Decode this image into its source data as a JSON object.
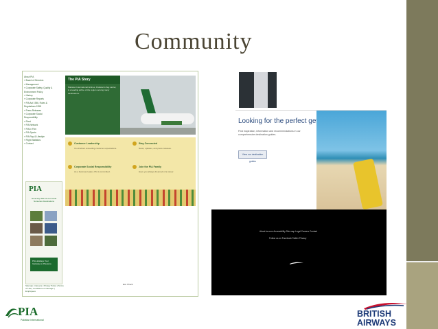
{
  "slide": {
    "title": "Community"
  },
  "pia_screenshot": {
    "sidebar_items": [
      "About PIA",
      "» Board of Directors",
      "» Management",
      "» Corporate Safety, Quality &",
      "  Environment Policy",
      "» History",
      "» Corporate Reports",
      "» PIA Act 1956, Rules &",
      "  Regulations 1958",
      "» Press Releases",
      "» Corporate Social",
      "  Responsibility",
      "» Fleet",
      "» PIA Network",
      "» PIA in Film",
      "» PIA Sports",
      "» PIA Rap & Lifestyle",
      "» Flight Statistics",
      "» Contact"
    ],
    "story_heading": "The PIA Story",
    "story_text": "Pakistan International Airlines, Pakistan's flag carrier, is a leading airline of the region serving many destinations.",
    "ad_logo": "PIA",
    "ad_text": "Great Fly With Us for Great Nurseries Destinations",
    "ad_green_text": "PIA Holidays Your Gateway to Pleasure",
    "mid_blocks": [
      {
        "heading": "Customer Leadership",
        "text": "It's all about exceeding customer expectations."
      },
      {
        "heading": "Stay Connected",
        "text": "News, updates, and press releases."
      },
      {
        "heading": "Corporate Social Responsibility",
        "text": "As a business leader, PIA is committed."
      },
      {
        "heading": "Join the PIA Family",
        "text": "Have you always dreamed of a career."
      }
    ],
    "footer_text": "Sitemap | Careers | Privacy Policy | Terms of Use | Conditions of Carriage | Employees",
    "footer_right": "Eco Check"
  },
  "ba_screenshot": {
    "heading": "Looking for the perfect getaway?",
    "text": "Find inspiration, information and recommendations in our comprehensive destination guides.",
    "button": "View our destination guides",
    "footer_links": "About ba.com   Accessibility   Site map   Legal   Careers   Contact",
    "footer_links2": "Follow us on Facebook   Twitter   Privacy"
  },
  "logos": {
    "pia_wordmark": "PIA",
    "pia_subtitle": "Pakistan International",
    "ba_line1": "BRITISH",
    "ba_line2": "AIRWAYS"
  },
  "colors": {
    "accent_title": "#4a4433",
    "pia_green": "#1a6b2a",
    "ba_blue": "#1e3b78",
    "side_bar": "#7d7a5c"
  }
}
